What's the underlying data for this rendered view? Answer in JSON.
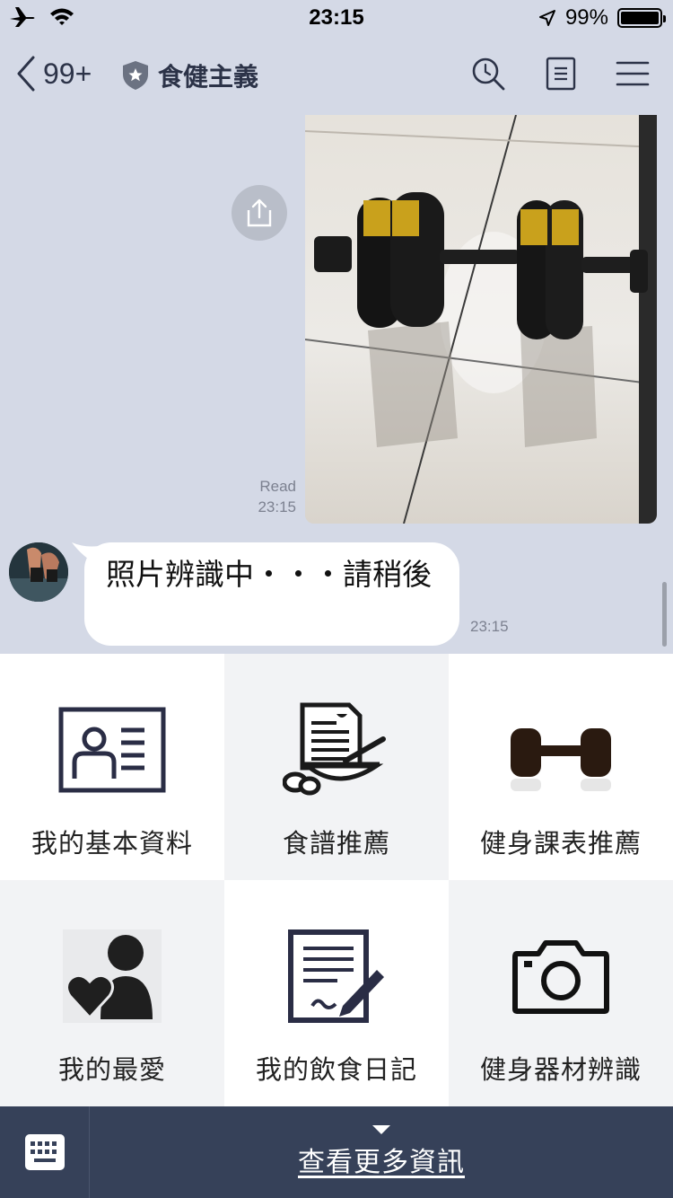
{
  "status_bar": {
    "time": "23:15",
    "battery": "99%",
    "battery_level": 0.99,
    "icons": [
      "airplane-icon",
      "wifi-icon",
      "location-arrow-icon",
      "battery-icon"
    ]
  },
  "nav": {
    "back_count": "99+",
    "chat_title": "食健主義",
    "icons": [
      "back-chevron-icon",
      "shield-star-icon",
      "search-icon",
      "notes-icon",
      "menu-icon"
    ]
  },
  "chat": {
    "outgoing": {
      "read_label": "Read",
      "time": "23:15",
      "image_subject": "dumbbell-photo"
    },
    "incoming": {
      "text": "照片辨識中・・・請稍後",
      "time": "23:15"
    }
  },
  "rich_menu": {
    "items": [
      {
        "label": "我的基本資料",
        "icon": "profile-card-icon"
      },
      {
        "label": "食譜推薦",
        "icon": "recipe-bowl-icon"
      },
      {
        "label": "健身課表推薦",
        "icon": "dumbbell-icon"
      },
      {
        "label": "我的最愛",
        "icon": "heart-person-icon"
      },
      {
        "label": "我的飲食日記",
        "icon": "diary-pen-icon"
      },
      {
        "label": "健身器材辨識",
        "icon": "camera-icon"
      }
    ]
  },
  "bottom_bar": {
    "more_label": "查看更多資訊",
    "keyboard_icon": "keyboard-icon"
  },
  "colors": {
    "chat_bg": "#d4d9e6",
    "bottom_bar_bg": "#364159",
    "nav_text": "#2c3348"
  }
}
